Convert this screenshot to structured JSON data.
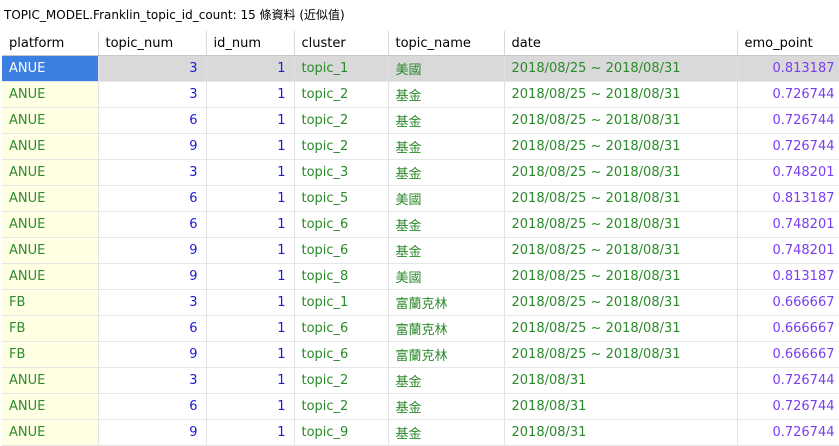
{
  "caption": "TOPIC_MODEL.Franklin_topic_id_count: 15 條資料 (近似值)",
  "columns": [
    "platform",
    "topic_num",
    "id_num",
    "cluster",
    "topic_name",
    "date",
    "emo_point"
  ],
  "selected_row": 0,
  "rows": [
    [
      "ANUE",
      "3",
      "1",
      "topic_1",
      "美國",
      "2018/08/25 ~ 2018/08/31",
      "0.813187"
    ],
    [
      "ANUE",
      "3",
      "1",
      "topic_2",
      "基金",
      "2018/08/25 ~ 2018/08/31",
      "0.726744"
    ],
    [
      "ANUE",
      "6",
      "1",
      "topic_2",
      "基金",
      "2018/08/25 ~ 2018/08/31",
      "0.726744"
    ],
    [
      "ANUE",
      "9",
      "1",
      "topic_2",
      "基金",
      "2018/08/25 ~ 2018/08/31",
      "0.726744"
    ],
    [
      "ANUE",
      "3",
      "1",
      "topic_3",
      "基金",
      "2018/08/25 ~ 2018/08/31",
      "0.748201"
    ],
    [
      "ANUE",
      "6",
      "1",
      "topic_5",
      "美國",
      "2018/08/25 ~ 2018/08/31",
      "0.813187"
    ],
    [
      "ANUE",
      "6",
      "1",
      "topic_6",
      "基金",
      "2018/08/25 ~ 2018/08/31",
      "0.748201"
    ],
    [
      "ANUE",
      "9",
      "1",
      "topic_6",
      "基金",
      "2018/08/25 ~ 2018/08/31",
      "0.748201"
    ],
    [
      "ANUE",
      "9",
      "1",
      "topic_8",
      "美國",
      "2018/08/25 ~ 2018/08/31",
      "0.813187"
    ],
    [
      "FB",
      "3",
      "1",
      "topic_1",
      "富蘭克林",
      "2018/08/25 ~ 2018/08/31",
      "0.666667"
    ],
    [
      "FB",
      "6",
      "1",
      "topic_6",
      "富蘭克林",
      "2018/08/25 ~ 2018/08/31",
      "0.666667"
    ],
    [
      "FB",
      "9",
      "1",
      "topic_6",
      "富蘭克林",
      "2018/08/25 ~ 2018/08/31",
      "0.666667"
    ],
    [
      "ANUE",
      "3",
      "1",
      "topic_2",
      "基金",
      "2018/08/31",
      "0.726744"
    ],
    [
      "ANUE",
      "6",
      "1",
      "topic_2",
      "基金",
      "2018/08/31",
      "0.726744"
    ],
    [
      "ANUE",
      "9",
      "1",
      "topic_9",
      "基金",
      "2018/08/31",
      "0.726744"
    ]
  ]
}
